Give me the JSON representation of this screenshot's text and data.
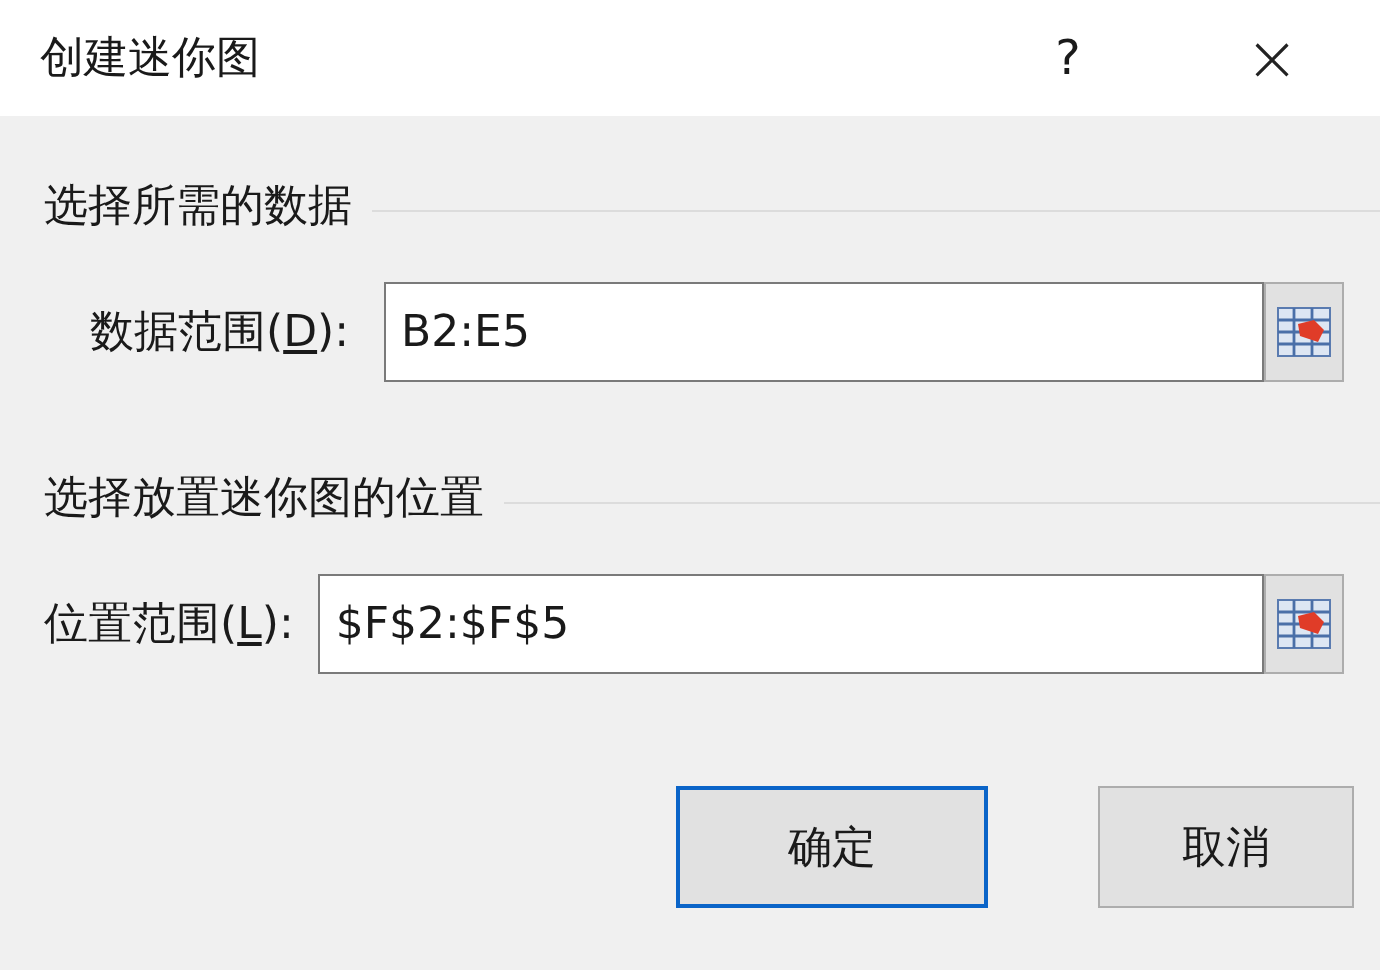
{
  "window": {
    "title": "创建迷你图",
    "help": "?",
    "close": "×"
  },
  "sections": [
    {
      "title": "选择所需的数据",
      "field": {
        "label_before": "数据范围(",
        "access_key": "D",
        "label_after": "):",
        "value": "B2:E5"
      }
    },
    {
      "title": "选择放置迷你图的位置",
      "field": {
        "label_before": "位置范围(",
        "access_key": "L",
        "label_after": "):",
        "value": "$F$2:$F$5"
      }
    }
  ],
  "buttons": [
    {
      "label": "确定",
      "default": true
    },
    {
      "label": "取消",
      "default": false
    }
  ]
}
